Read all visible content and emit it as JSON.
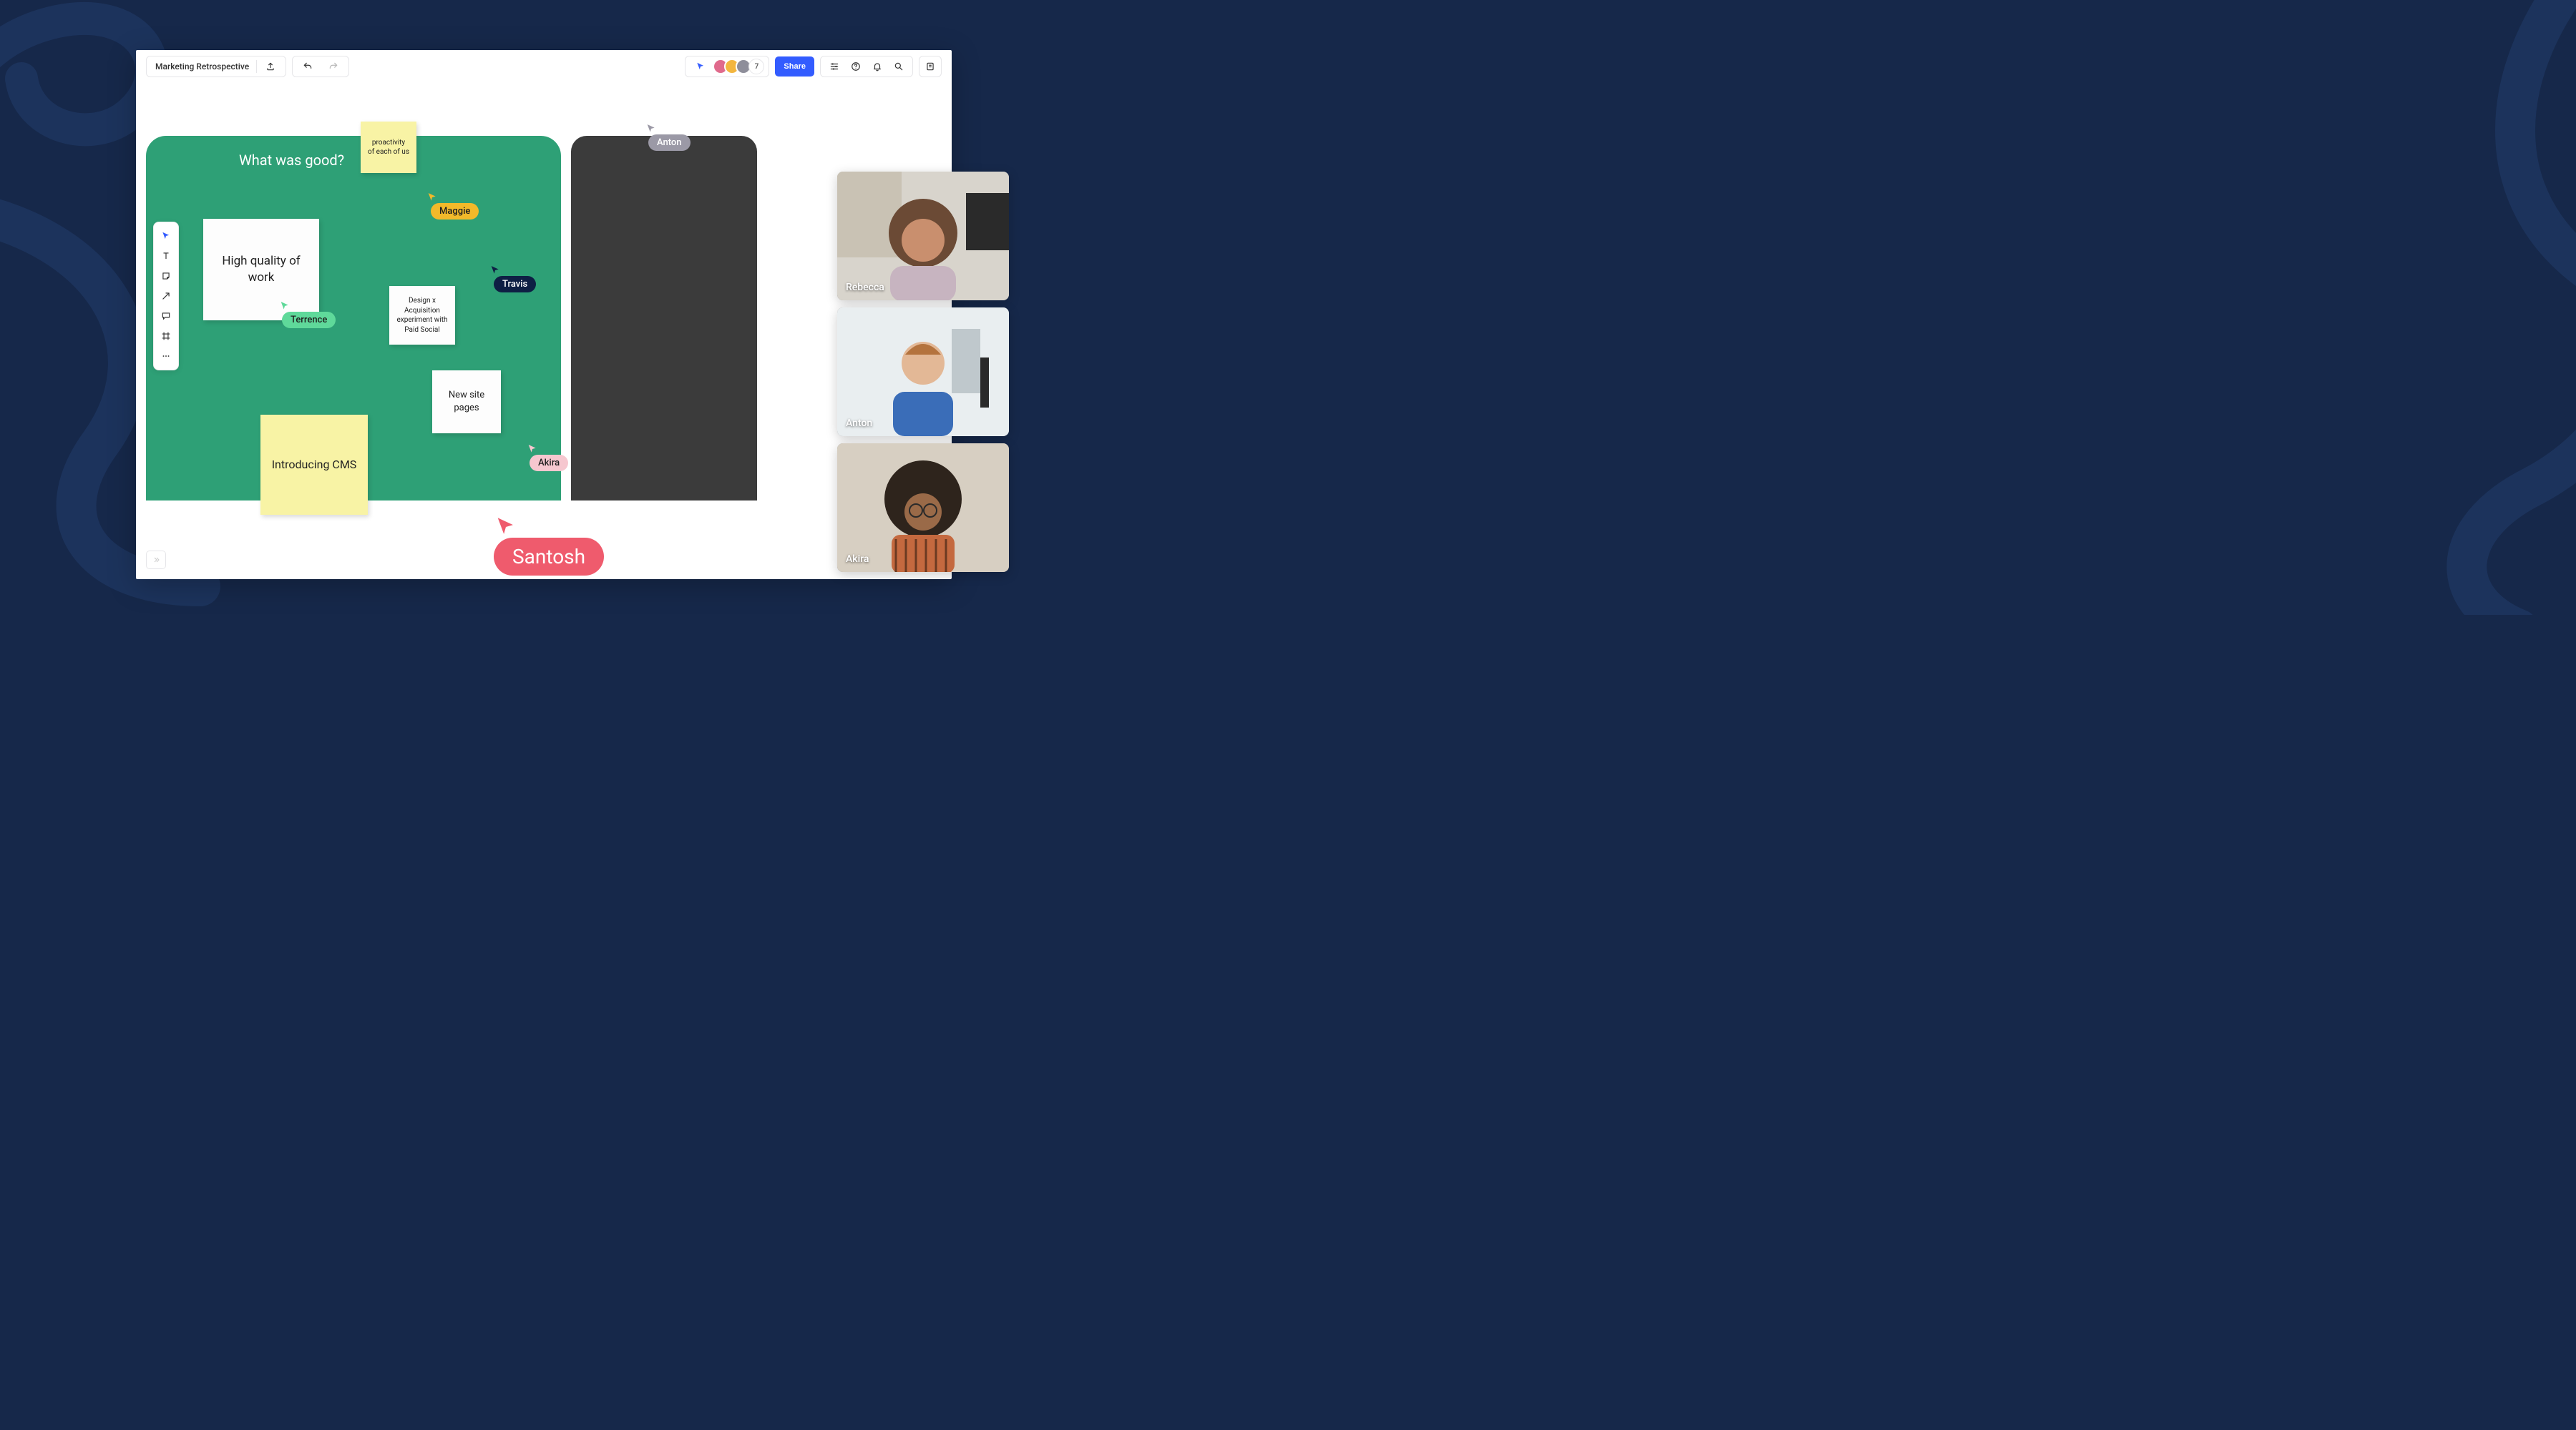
{
  "header": {
    "title": "Marketing Retrospective",
    "share_label": "Share",
    "participant_count": "7"
  },
  "board": {
    "green_title": "What was good?",
    "notes": {
      "proactivity": "proactivity\nof each of us",
      "high_quality": "High quality\nof  work",
      "design_x": "Design x\nAcquisition\nexperiment with\nPaid Social",
      "new_site": "New site\npages",
      "intro_cms": "Introducing\nCMS"
    }
  },
  "cursors": {
    "maggie": {
      "label": "Maggie",
      "color": "#f2b92a",
      "text": "#1f1f1f"
    },
    "terrence": {
      "label": "Terrence",
      "color": "#5fd99a",
      "text": "#1f1f1f"
    },
    "travis": {
      "label": "Travis",
      "color": "#0e1f44",
      "text": "#ffffff"
    },
    "akira": {
      "label": "Akira",
      "color": "#f6c7cf",
      "text": "#1f1f1f"
    },
    "anton": {
      "label": "Anton",
      "color": "#9b99a6",
      "text": "#ffffff"
    },
    "santosh": {
      "label": "Santosh",
      "color": "#ef5b6d",
      "text": "#ffffff"
    }
  },
  "videos": {
    "rebecca": "Rebecca",
    "anton": "Anton",
    "akira": "Akira"
  },
  "colors": {
    "avatars": [
      "#e06a8c",
      "#f3b63f",
      "#8e8e9a"
    ]
  }
}
